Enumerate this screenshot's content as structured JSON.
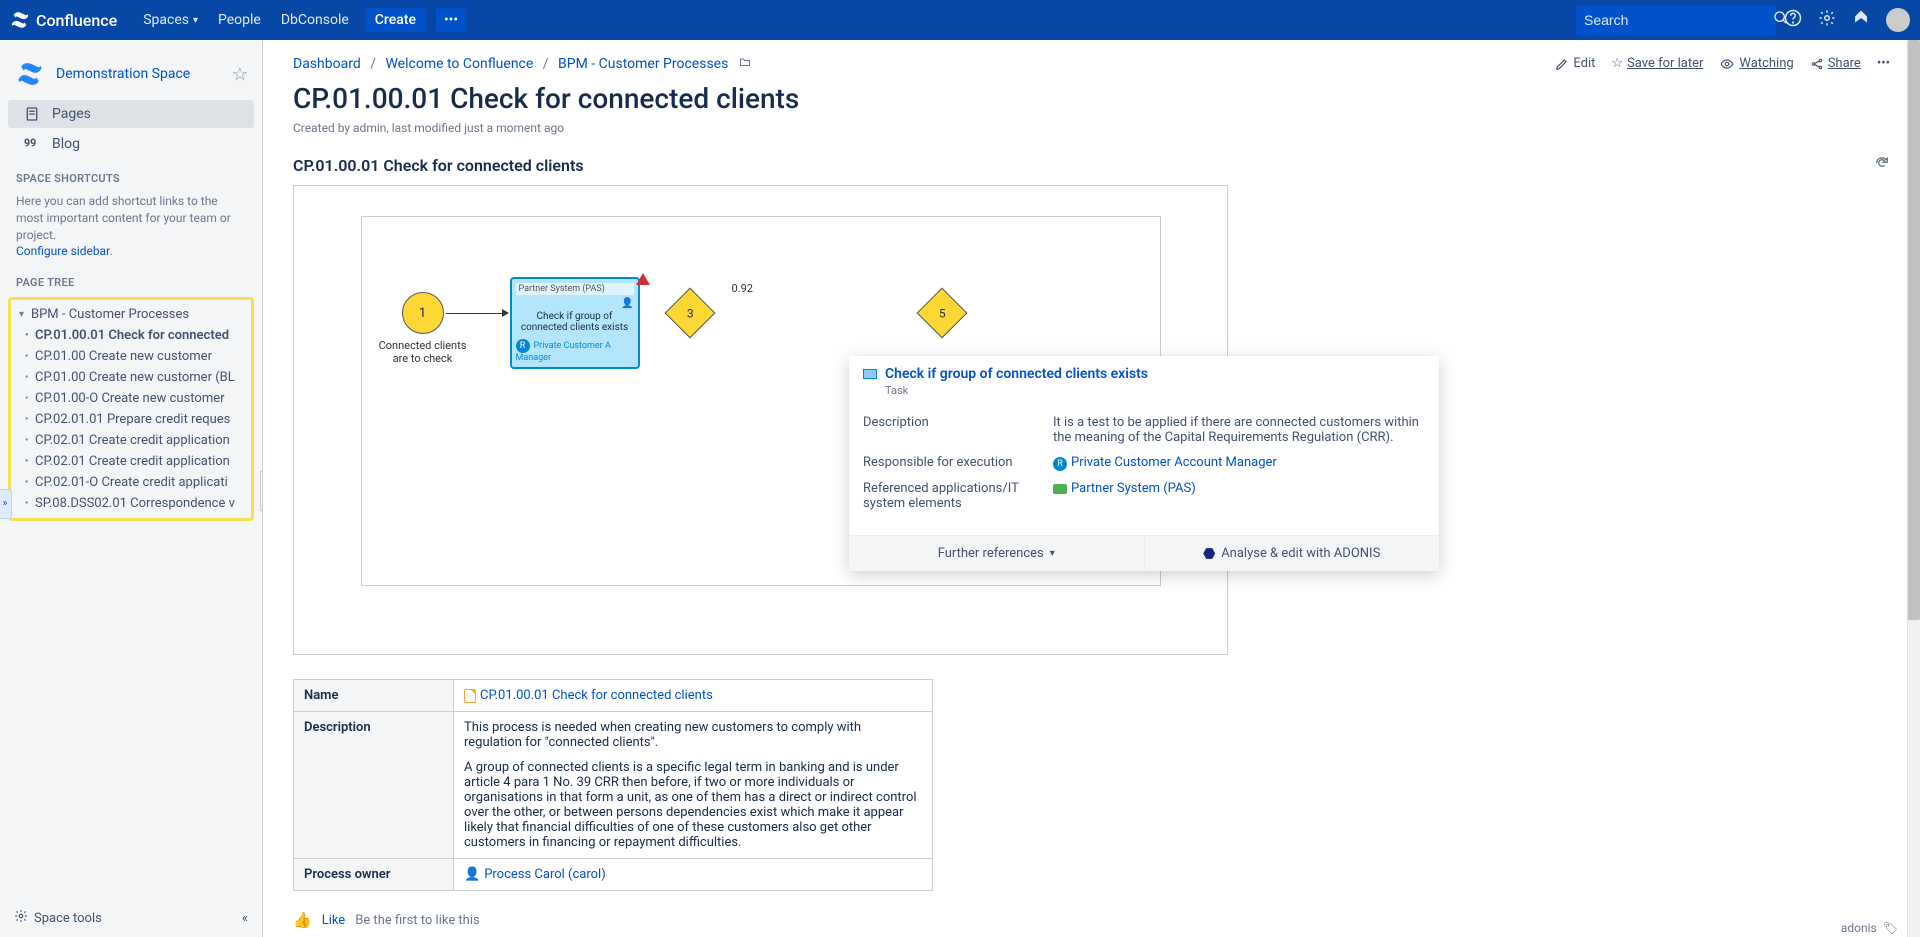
{
  "brand": "Confluence",
  "nav": {
    "spaces": "Spaces",
    "people": "People",
    "dbconsole": "DbConsole",
    "create": "Create",
    "more": "•••"
  },
  "search": {
    "placeholder": "Search"
  },
  "space": {
    "name": "Demonstration Space",
    "pages": "Pages",
    "blog": "Blog",
    "shortcuts_label": "SPACE SHORTCUTS",
    "shortcuts_hint": "Here you can add shortcut links to the most important content for your team or project.",
    "configure": "Configure sidebar",
    "pagetree_label": "PAGE TREE",
    "tree_root": "BPM - Customer Processes",
    "tree_items": [
      "CP.01.00.01 Check for connected",
      "CP.01.00 Create new customer",
      "CP.01.00 Create new customer (BL",
      "CP.01.00-O Create new customer",
      "CP.02.01.01 Prepare credit reques",
      "CP.02.01 Create credit application",
      "CP.02.01 Create credit application",
      "CP.02.01-O Create credit applicati",
      "SP.08.DSS02.01 Correspondence v"
    ],
    "tools": "Space tools"
  },
  "breadcrumbs": [
    "Dashboard",
    "Welcome to Confluence",
    "BPM - Customer Processes"
  ],
  "actions": {
    "edit": "Edit",
    "save": "Save for later",
    "watching": "Watching",
    "share": "Share"
  },
  "page": {
    "title": "CP.01.00.01 Check for connected clients",
    "meta": "Created by admin, last modified just a moment ago",
    "section_title": "CP.01.00.01 Check for connected clients"
  },
  "diagram": {
    "start_num": "1",
    "start_label": "Connected clients are to check",
    "task_system": "Partner System (PAS)",
    "task_body": "Check if group of connected clients exists",
    "task_role": "Private Customer A Manager",
    "d1": "3",
    "d2": "5",
    "edge": "0.92"
  },
  "popup": {
    "title": "Check if group of connected clients exists",
    "sub": "Task",
    "desc_k": "Description",
    "desc_v": "It is a test to be applied if there are connected customers within the meaning of the Capital Requirements Regulation (CRR).",
    "resp_k": "Responsible for execution",
    "resp_v": "Private Customer Account Manager",
    "ref_k": "Referenced applications/IT system elements",
    "ref_v": "Partner System (PAS)",
    "further": "Further references",
    "analyse": "Analyse & edit with ADONIS"
  },
  "table": {
    "name_k": "Name",
    "name_v": "CP.01.00.01 Check for connected clients",
    "desc_k": "Description",
    "desc_v1": "This process is needed when creating new customers to comply with regulation for \"connected clients\".",
    "desc_v2": "A group of connected clients is a specific legal term in banking and is under article 4 para 1 No. 39 CRR then before, if two or more individuals or organisations in that form a unit, as one of them has a direct or indirect control over the other, or between persons dependencies exist which make it appear likely that financial difficulties of one of these customers also get other customers in financing or repayment difficulties.",
    "owner_k": "Process owner",
    "owner_v": "Process Carol (carol)"
  },
  "like": {
    "like": "Like",
    "first": "Be the first to like this"
  },
  "tag": "adonis"
}
